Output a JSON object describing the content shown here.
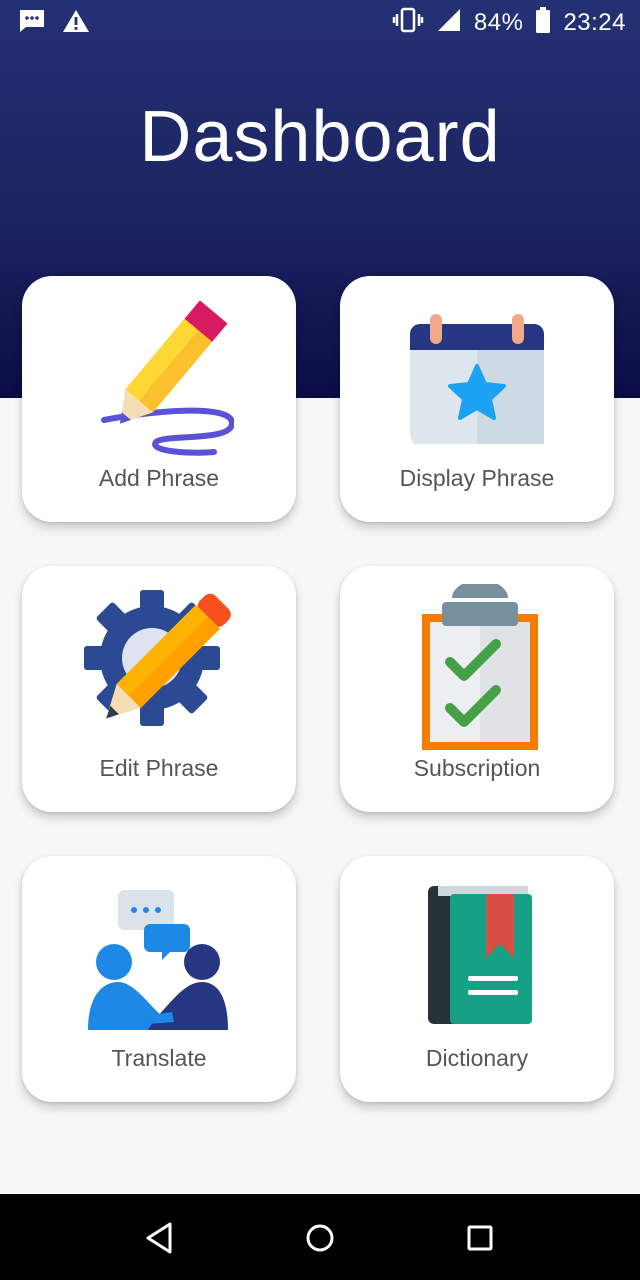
{
  "status_bar": {
    "icons": [
      "message-icon",
      "warning-icon",
      "vibrate-icon",
      "signal-icon",
      "battery-icon"
    ],
    "battery": "84%",
    "time": "23:24"
  },
  "header": {
    "title": "Dashboard"
  },
  "cards": [
    {
      "label": "Add Phrase",
      "icon": "pencil-icon"
    },
    {
      "label": "Display Phrase",
      "icon": "calendar-star-icon"
    },
    {
      "label": "Edit Phrase",
      "icon": "gear-pencil-icon"
    },
    {
      "label": "Subscription",
      "icon": "clipboard-check-icon"
    },
    {
      "label": "Translate",
      "icon": "people-chat-icon"
    },
    {
      "label": "Dictionary",
      "icon": "book-icon"
    }
  ],
  "nav": [
    "back-icon",
    "home-icon",
    "recents-icon"
  ],
  "colors": {
    "header_top": "#243174",
    "header_bottom": "#0b0c46",
    "background": "#f7f7f7"
  }
}
